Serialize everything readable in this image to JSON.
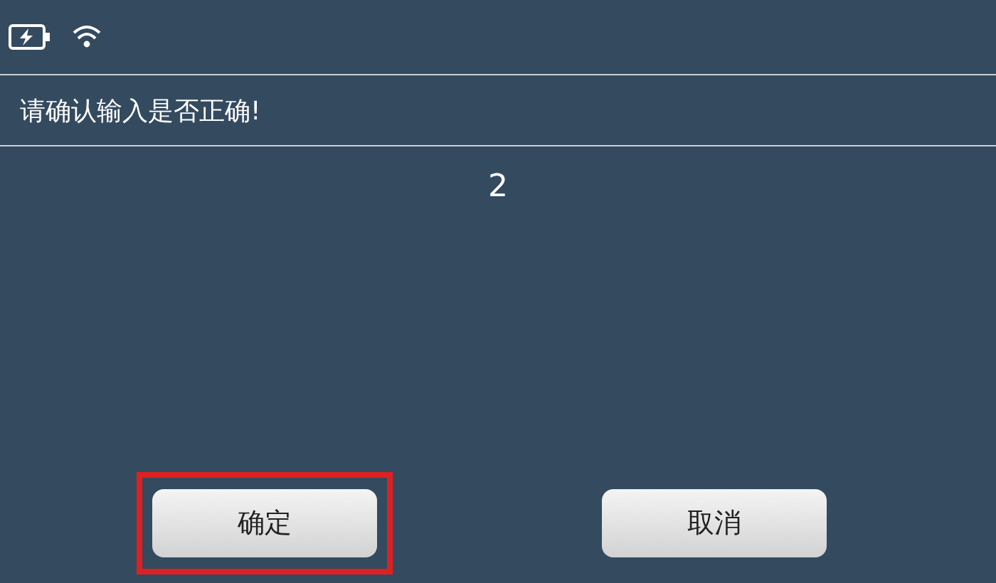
{
  "status_bar": {
    "battery_charging": true
  },
  "prompt": "请确认输入是否正确!",
  "value": "2",
  "buttons": [
    {
      "label": "确定",
      "highlighted": true
    },
    {
      "label": "取消",
      "highlighted": false
    }
  ]
}
